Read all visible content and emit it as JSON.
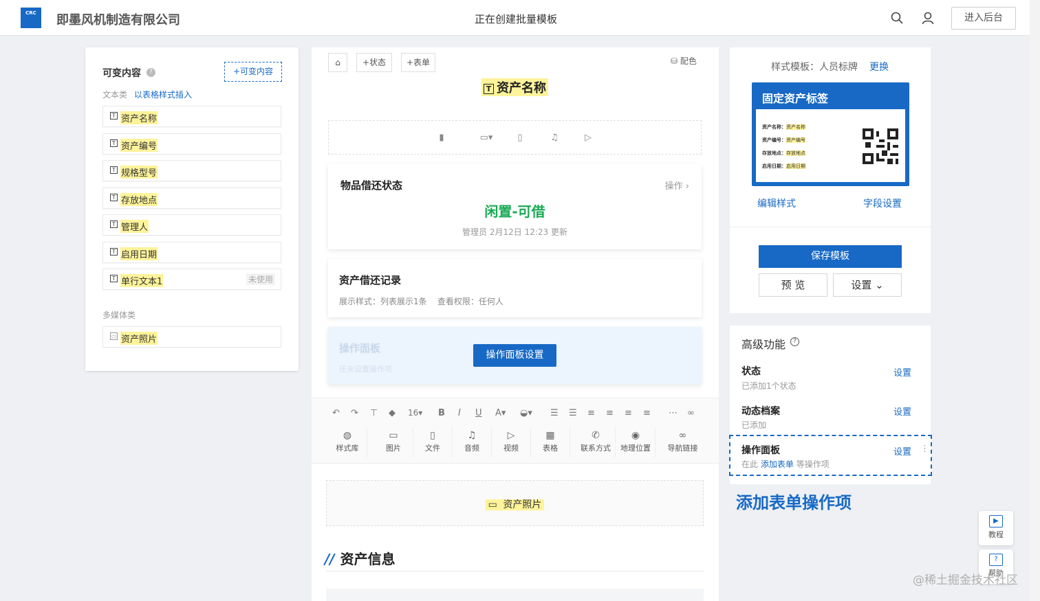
{
  "header": {
    "logo_text": "CRC",
    "company": "即墨风机制造有限公司",
    "title": "正在创建批量模板",
    "enter_backend": "进入后台"
  },
  "left": {
    "title": "可变内容",
    "add_label": "+可变内容",
    "text_category": "文本类",
    "insert_table": "以表格样式插入",
    "text_fields": [
      {
        "label": "资产名称",
        "status": ""
      },
      {
        "label": "资产编号",
        "status": ""
      },
      {
        "label": "规格型号",
        "status": ""
      },
      {
        "label": "存放地点",
        "status": ""
      },
      {
        "label": "管理人",
        "status": ""
      },
      {
        "label": "启用日期",
        "status": ""
      },
      {
        "label": "单行文本1",
        "status": "未使用"
      }
    ],
    "media_category": "多媒体类",
    "media_fields": [
      {
        "label": "资产照片"
      }
    ]
  },
  "center": {
    "toolbar": {
      "add_status": "+状态",
      "add_form": "+表单",
      "color": "配色"
    },
    "asset_name_title": "资产名称",
    "status_card": {
      "title": "物品借还状态",
      "operate": "操作 ›",
      "value": "闲置-可借",
      "update": "管理员 2月12日 12:23 更新"
    },
    "record_card": {
      "title": "资产借还记录",
      "subtitle": "展示样式：列表展示1条    查看权限：任何人"
    },
    "panel_card": {
      "title": "操作面板",
      "subtitle": "还未设置操作项",
      "button": "操作面板设置"
    },
    "editor": {
      "font_size": "16",
      "insert_items": [
        "样式库",
        "图片",
        "文件",
        "音频",
        "视频",
        "表格",
        "联系方式",
        "地理位置",
        "导航链接"
      ]
    },
    "photo_label": "资产照片",
    "asset_info": "资产信息"
  },
  "right": {
    "template_label": "样式模板：人员标牌",
    "change": "更换",
    "tag": {
      "title": "固定资产标签",
      "rows": [
        {
          "key": "资产名称：",
          "val": "资产名称"
        },
        {
          "key": "资产编号：",
          "val": "资产编号"
        },
        {
          "key": "存放地点：",
          "val": "存放地点"
        },
        {
          "key": "启用日期：",
          "val": "启用日期"
        }
      ]
    },
    "edit_style": "编辑样式",
    "field_settings": "字段设置",
    "save_template": "保存模板",
    "preview": "预 览",
    "settings": "设置 ⌄"
  },
  "advanced": {
    "title": "高级功能",
    "items": [
      {
        "name": "状态",
        "sub": "已添加1个状态",
        "action": "设置"
      },
      {
        "name": "动态档案",
        "sub": "已添加",
        "action": "设置"
      },
      {
        "name": "操作面板",
        "sub_prefix": "在此",
        "sub_link": "添加表单",
        "sub_suffix": "等操作项",
        "action": "设置"
      }
    ],
    "callout": "添加表单操作项"
  },
  "floating": {
    "tutorial": "教程",
    "feedback": "帮助"
  },
  "watermark": "@稀土掘金技术社区"
}
